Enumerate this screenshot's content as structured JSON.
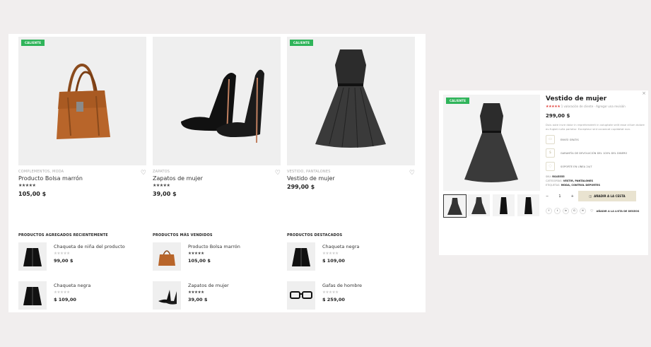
{
  "products": [
    {
      "badge": "CALIENTE",
      "category": "COMPLEMENTOS, MODA",
      "title": "Producto Bolsa marrón",
      "stars": "★★★★★",
      "price": "105,00 $"
    },
    {
      "badge": "",
      "category": "ZAPATOS",
      "title": "Zapatos de mujer",
      "stars": "★★★★★",
      "price": "39,00 $"
    },
    {
      "badge": "CALIENTE",
      "category": "VESTIDO, PANTALONES",
      "title": "Vestido de mujer",
      "stars": "",
      "price": "299,00 $"
    }
  ],
  "columns": [
    {
      "heading": "PRODUCTOS AGREGADOS RECIENTEMENTE",
      "items": [
        {
          "name": "Chaqueta de niña del producto",
          "stars": "★★★★★",
          "price": "99,00 $"
        },
        {
          "name": "Chaqueta negra",
          "stars": "★★★★★",
          "price": "$ 109,00"
        }
      ]
    },
    {
      "heading": "PRODUCTOS MÁS VENDIDOS",
      "items": [
        {
          "name": "Producto Bolsa marrón",
          "stars": "★★★★★",
          "price": "105,00 $"
        },
        {
          "name": "Zapatos de mujer",
          "stars": "★★★★★",
          "price": "39,00 $"
        }
      ]
    },
    {
      "heading": "PRODUCTOS DESTACADOS",
      "items": [
        {
          "name": "Chaqueta negra",
          "stars": "★★★★★",
          "price": "$ 109,00"
        },
        {
          "name": "Gafas de hombre",
          "stars": "★★★★★",
          "price": "$ 259,00"
        }
      ]
    }
  ],
  "quickview": {
    "badge": "CALIENTE",
    "title": "Vestido de mujer",
    "stars": "★★★★★",
    "reviews": "1 valoración de cliente",
    "add_review": "Agregar una revisión",
    "price": "299,00 $",
    "description": "Duis aute irure dolor in reprehenderit in voluptate velit esse cillum dolore eu fugiat nulla pariatur. Excepteur sint occaecat cupidatat non.",
    "features": [
      "ENVÍO GRATIS",
      "GARANTÍA DE DEVOLUCIÓN DEL 100% DEL DINERO",
      "SOPORTE EN LÍNEA 24/7"
    ],
    "sku_label": "SKU:",
    "sku": "RS45555",
    "categories_label": "CATEGORÍAS:",
    "categories": "VESTIR, PANTALONES",
    "tags_label": "ETIQUETAS:",
    "tags": "MODA, CONTROL DEPORTES",
    "qty_minus": "−",
    "qty": "1",
    "qty_plus": "+",
    "cart_label": "AÑADIR A LA CESTA",
    "wishlist_label": "AÑADIR A LA LISTA DE DESEOS",
    "share": [
      "f",
      "t",
      "in",
      "G",
      "✉"
    ],
    "close": "×"
  },
  "colors": {
    "badge": "#2fb45a",
    "accent_stars": "#e0423c",
    "cart_button": "#e9e3d0"
  }
}
